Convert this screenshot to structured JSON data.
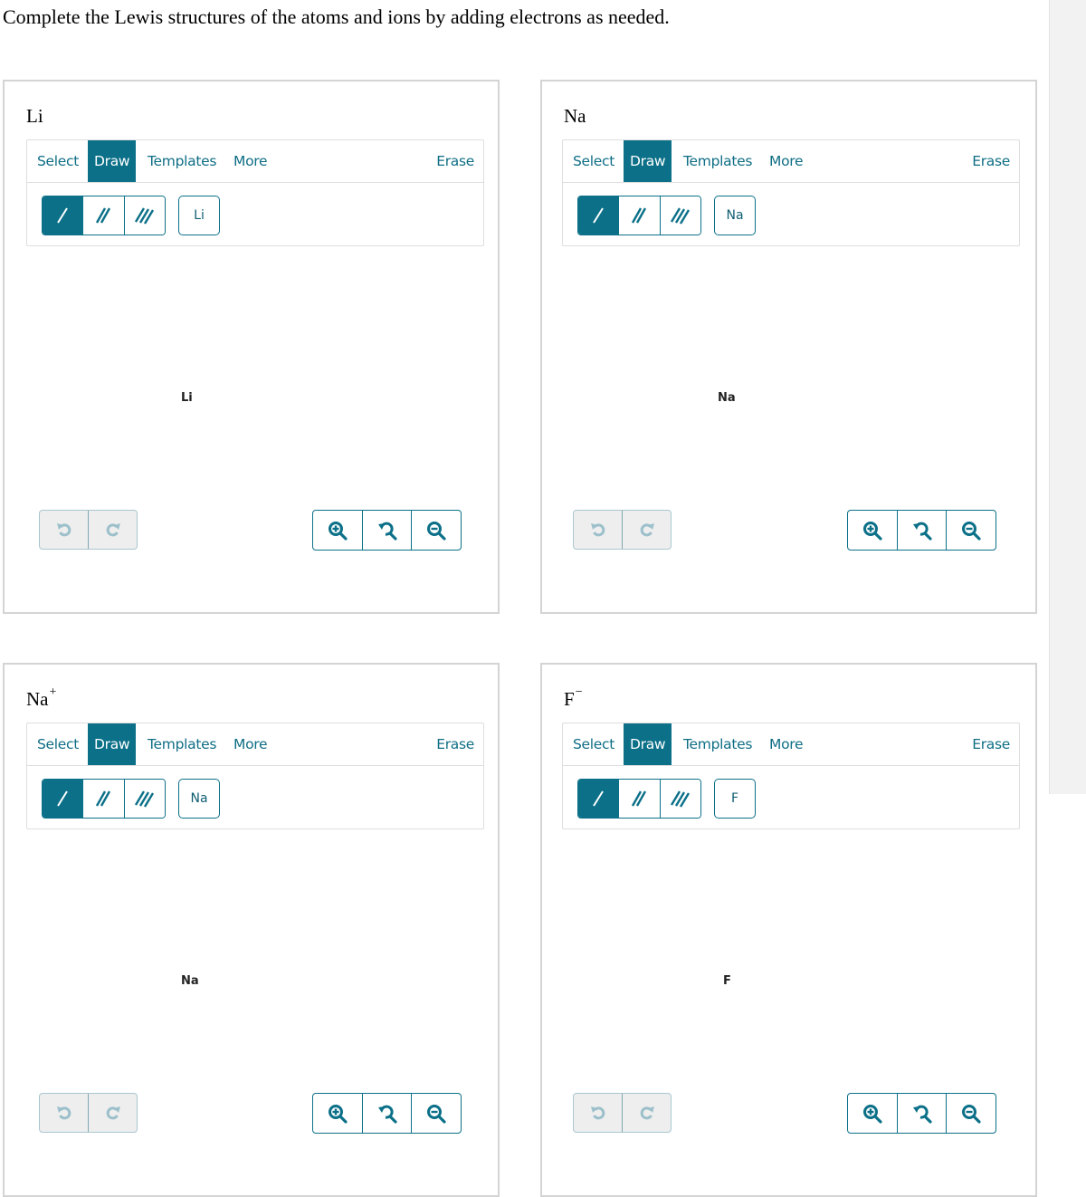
{
  "instructions": "Complete the Lewis structures of the atoms and ions by adding electrons as needed.",
  "colors": {
    "accent": "#0b7088",
    "disabled": "#a9c6cf",
    "panel_border": "#d4d4d4"
  },
  "toolbar_labels": {
    "select": "Select",
    "draw": "Draw",
    "templates": "Templates",
    "more": "More",
    "erase": "Erase"
  },
  "icons": {
    "single_bond": "single-bond-icon",
    "double_bond": "double-bond-icon",
    "triple_bond": "triple-bond-icon",
    "undo": "undo-icon",
    "redo": "redo-icon",
    "zoom_in": "zoom-in-icon",
    "zoom_reset": "zoom-reset-icon",
    "zoom_out": "zoom-out-icon"
  },
  "panels": [
    {
      "label": "Li",
      "charge": "",
      "element_button": "Li",
      "canvas_atom": "Li",
      "active_tab": "Draw",
      "active_bond": "single"
    },
    {
      "label": "Na",
      "charge": "",
      "element_button": "Na",
      "canvas_atom": "Na",
      "active_tab": "Draw",
      "active_bond": "single"
    },
    {
      "label": "Na",
      "charge": "+",
      "element_button": "Na",
      "canvas_atom": "Na",
      "active_tab": "Draw",
      "active_bond": "single"
    },
    {
      "label": "F",
      "charge": "−",
      "element_button": "F",
      "canvas_atom": "F",
      "active_tab": "Draw",
      "active_bond": "single"
    }
  ]
}
